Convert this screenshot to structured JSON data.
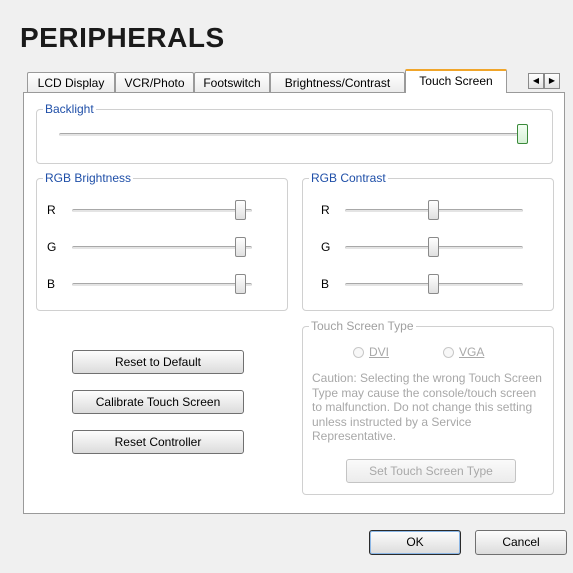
{
  "page_title": "PERIPHERALS",
  "tabs": [
    {
      "label": "LCD Display",
      "active": false
    },
    {
      "label": "VCR/Photo",
      "active": false
    },
    {
      "label": "Footswitch",
      "active": false
    },
    {
      "label": "Brightness/Contrast",
      "active": false
    },
    {
      "label": "Touch Screen",
      "active": true
    }
  ],
  "tab_scroll": {
    "left": "◀",
    "right": "▶"
  },
  "backlight": {
    "label": "Backlight",
    "value": 1.0
  },
  "rgb_brightness": {
    "label": "RGB Brightness",
    "channels": [
      {
        "name": "R",
        "value": 1.0
      },
      {
        "name": "G",
        "value": 1.0
      },
      {
        "name": "B",
        "value": 1.0
      }
    ]
  },
  "rgb_contrast": {
    "label": "RGB Contrast",
    "channels": [
      {
        "name": "R",
        "value": 0.5
      },
      {
        "name": "G",
        "value": 0.5
      },
      {
        "name": "B",
        "value": 0.5
      }
    ]
  },
  "buttons": {
    "reset_default": "Reset to Default",
    "calibrate": "Calibrate Touch Screen",
    "reset_controller": "Reset Controller"
  },
  "touch_type": {
    "label": "Touch Screen Type",
    "dvi": "DVI",
    "vga": "VGA",
    "caution": "Caution: Selecting the wrong Touch Screen Type may cause the console/touch screen to malfunction. Do not change this setting unless instructed by a Service Representative.",
    "set_button": "Set Touch Screen Type"
  },
  "dialog": {
    "ok": "OK",
    "cancel": "Cancel"
  }
}
